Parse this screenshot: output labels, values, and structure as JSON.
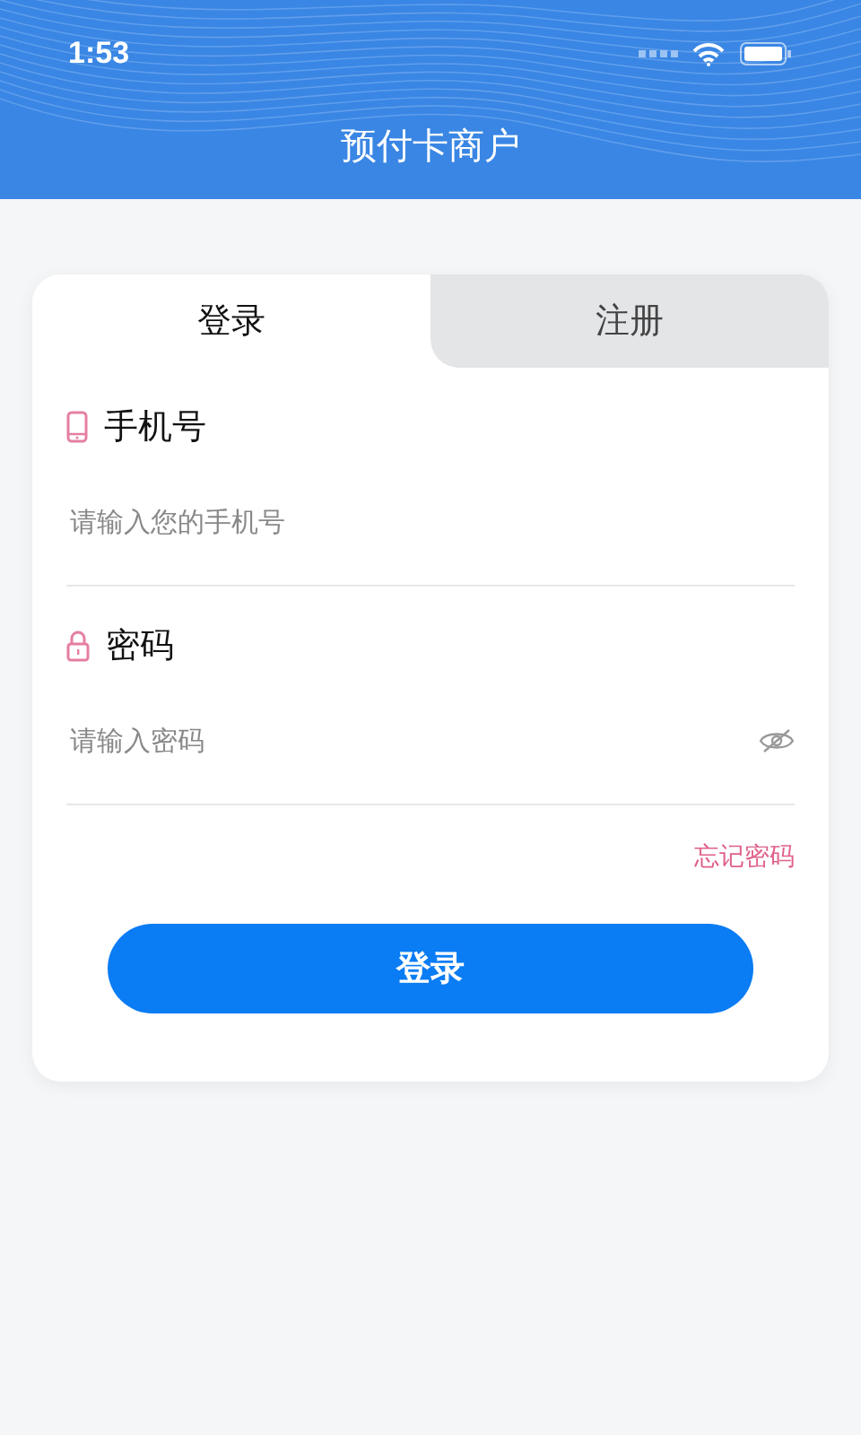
{
  "status_bar": {
    "time": "1:53"
  },
  "header": {
    "title": "预付卡商户"
  },
  "tabs": [
    {
      "label": "登录",
      "selected": true
    },
    {
      "label": "注册",
      "selected": false
    }
  ],
  "fields": [
    {
      "kind": "phone",
      "label": "手机号",
      "placeholder": "请输入您的手机号"
    },
    {
      "kind": "password",
      "label": "密码",
      "placeholder": "请输入密码",
      "visible": false
    }
  ],
  "forgot_link": "忘记密码",
  "submit_button": "登录"
}
